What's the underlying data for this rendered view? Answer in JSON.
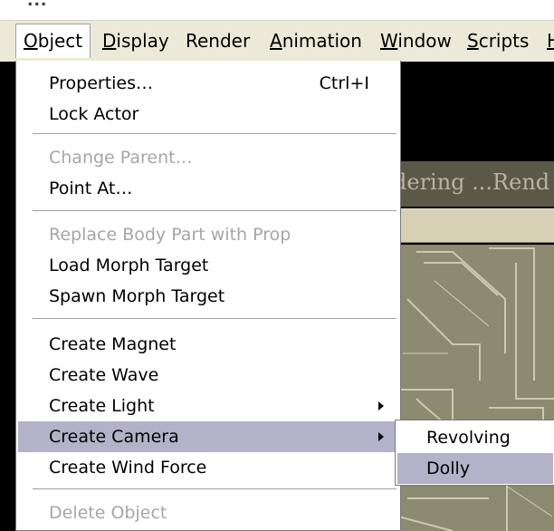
{
  "title_fragment": "...",
  "menubar": [
    {
      "pre": "",
      "key": "O",
      "post": "bject",
      "active": true
    },
    {
      "pre": "",
      "key": "D",
      "post": "isplay",
      "active": false
    },
    {
      "pre": "",
      "key": "",
      "post": "Render",
      "active": false
    },
    {
      "pre": "",
      "key": "A",
      "post": "nimation",
      "active": false
    },
    {
      "pre": "",
      "key": "W",
      "post": "indow",
      "active": false
    },
    {
      "pre": "",
      "key": "S",
      "post": "cripts",
      "active": false
    },
    {
      "pre": "",
      "key": "H",
      "post": "",
      "active": false
    }
  ],
  "background": {
    "render_text": "dering ...Rend"
  },
  "object_menu": {
    "items": [
      {
        "label": "Properties…",
        "shortcut": "Ctrl+I",
        "enabled": true
      },
      {
        "label": "Lock Actor",
        "enabled": true
      },
      {
        "label": "Change Parent…",
        "enabled": false
      },
      {
        "label": "Point At…",
        "enabled": true
      },
      {
        "label": "Replace Body Part with Prop",
        "enabled": false
      },
      {
        "label": "Load Morph Target",
        "enabled": true
      },
      {
        "label": "Spawn Morph Target",
        "enabled": true
      },
      {
        "label": "Create Magnet",
        "enabled": true
      },
      {
        "label": "Create Wave",
        "enabled": true
      },
      {
        "label": "Create Light",
        "enabled": true,
        "submenu": true
      },
      {
        "label": "Create Camera",
        "enabled": true,
        "submenu": true,
        "highlighted": true
      },
      {
        "label": "Create Wind Force",
        "enabled": true
      },
      {
        "label": "Delete Object",
        "enabled": false
      }
    ]
  },
  "camera_submenu": {
    "items": [
      {
        "label": "Revolving",
        "highlighted": false
      },
      {
        "label": "Dolly",
        "highlighted": true
      }
    ]
  },
  "colors": {
    "menubar_bg": "#ece9d8",
    "highlight": "#b4b2c8",
    "disabled_text": "#a6a6a6",
    "scene_bg": "#000000"
  }
}
